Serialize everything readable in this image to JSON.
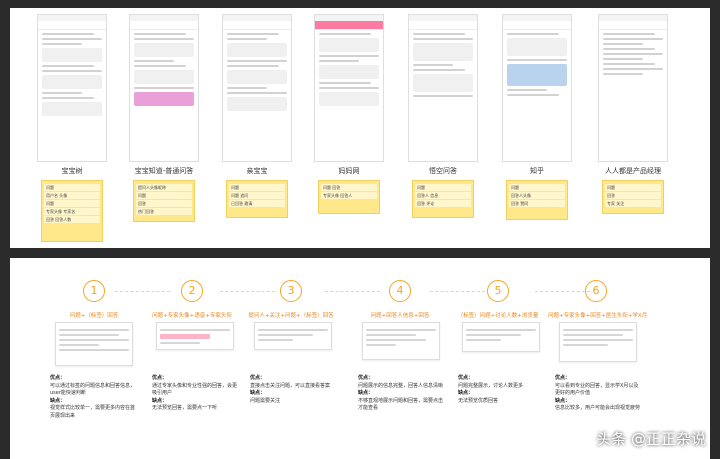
{
  "apps": [
    {
      "label": "宝宝树",
      "notes": [
        "问题",
        "用户名 头像",
        "问题",
        "专家头像 专家名",
        "回答 回答人数"
      ]
    },
    {
      "label": "宝宝知道-普通问答",
      "notes": [
        "提问人头像昵称",
        "问题",
        "回答",
        "热门回答"
      ]
    },
    {
      "label": "亲宝宝",
      "notes": [
        "问题",
        "问题 追问",
        "已回答 邀请"
      ]
    },
    {
      "label": "妈妈网",
      "notes": [
        "问题 回答",
        "专家头像 回答人"
      ]
    },
    {
      "label": "悟空问答",
      "notes": [
        "问题",
        "回答人 信息",
        "回答 评论"
      ]
    },
    {
      "label": "知乎",
      "notes": [
        "问题",
        "回答人头像",
        "回答 赞同"
      ]
    },
    {
      "label": "人人都是产品经理",
      "notes": [
        "问题",
        "回答",
        "专家 关注"
      ]
    }
  ],
  "steps": [
    {
      "num": "1",
      "caption": "问题+（标签）回答",
      "pros_h": "优点：",
      "pros": "可以通过标签的问题信息和回答信息，user能快速判断",
      "cons_h": "缺点：",
      "cons": "视觉样式比较单一，需要更多内容在首页展现出来"
    },
    {
      "num": "2",
      "caption": "问题+专家头像+语音+专家头衔",
      "pros_h": "优点：",
      "pros": "通过专家头像和专业性强的回答，会更吸引用户",
      "cons_h": "缺点：",
      "cons": "无法预览回答，需要点一下听"
    },
    {
      "num": "3",
      "caption": "提问人+关注+问题+（标签）回答",
      "pros_h": "优点：",
      "pros": "直接点击关注问题，可以直接看答案",
      "cons_h": "缺点：",
      "cons": "问题需要关注"
    },
    {
      "num": "4",
      "caption": "问题+回答人信息+回答",
      "pros_h": "优点：",
      "pros": "问题展示的信息完整，回答人信息清晰",
      "cons_h": "缺点：",
      "cons": "不够直观地展示问题和回答，需要点击才能查看"
    },
    {
      "num": "5",
      "caption": "（标签）问题+讨论人数+浏览量",
      "pros_h": "优点：",
      "pros": "问题完整展示，讨论人数更多",
      "cons_h": "缺点：",
      "cons": "无法预览优质回答"
    },
    {
      "num": "6",
      "caption": "问题+专家头像+回答+医生头衔+学X月",
      "pros_h": "优点：",
      "pros": "可以看到专业的回答，显示学X月以及更好的用户价值",
      "cons_h": "缺点：",
      "cons": "信息比较多，用户可能会出现视觉疲劳"
    }
  ],
  "watermark": "头条 @正正杂说"
}
